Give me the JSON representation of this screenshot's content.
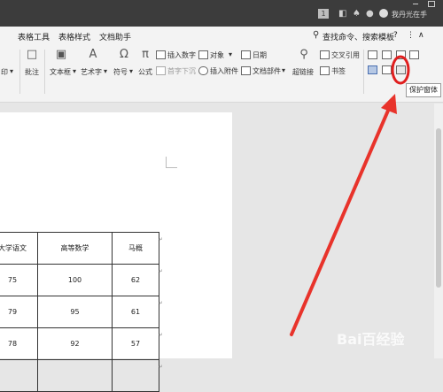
{
  "titlebar": {
    "badge": "1",
    "username": "我丹光在手"
  },
  "menu": {
    "items": [
      "表格工具",
      "表格样式",
      "文档助手"
    ],
    "search": "查找命令、搜索模板",
    "help": "?"
  },
  "ribbon": {
    "print_label": "印",
    "comment_label": "批注",
    "textbox_label": "文本框",
    "wordart_label": "艺术字",
    "symbol_label": "符号",
    "formula_label": "公式",
    "insert_number": "插入数字",
    "object_label": "对象",
    "date_label": "日期",
    "text_direction": "首字下沉",
    "insert_attachment": "插入附件",
    "doc_parts": "文档部件",
    "hyperlink_label": "超链接",
    "crossref_label": "交叉引用",
    "bookmark_label": "书签"
  },
  "tooltip": "保护窗体",
  "table": {
    "headers": [
      "大学语文",
      "高等数学",
      "马概"
    ],
    "rows": [
      [
        "75",
        "100",
        "62"
      ],
      [
        "79",
        "95",
        "61"
      ],
      [
        "78",
        "92",
        "57"
      ],
      [
        "",
        "",
        ""
      ]
    ]
  },
  "watermark": "Bai百经验",
  "colors": {
    "arrow": "#e8332b",
    "highlight_ring": "#e01f1f"
  }
}
